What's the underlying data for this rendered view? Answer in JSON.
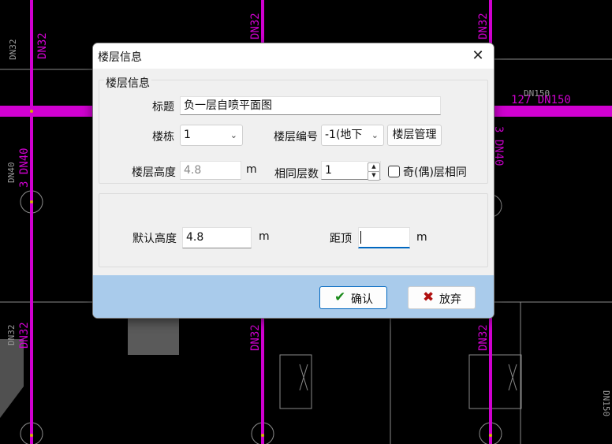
{
  "dialog": {
    "title": "楼层信息",
    "close_glyph": "✕",
    "group1_title": "楼层信息",
    "biaoti_label": "标题",
    "biaoti_value": "负一层自喷平面图",
    "loudong_label": "楼栋",
    "loudong_value": "1",
    "louceng_bianhao_label": "楼层编号",
    "louceng_bianhao_value": "-1(地下",
    "louceng_manage_button": "楼层管理",
    "louceng_gaodu_label": "楼层高度",
    "louceng_gaodu_value": "4.8",
    "unit_m": "m",
    "xiangtong_cengshu_label": "相同层数",
    "xiangtong_cengshu_value": "1",
    "jiou_label": "奇(偶)层相同",
    "moren_gaodu_label": "默认高度",
    "moren_gaodu_value": "4.8",
    "juding_label": "距顶",
    "juding_value": "",
    "ok_label": "确认",
    "cancel_label": "放弃"
  },
  "cad": {
    "labels": [
      "DN32",
      "DN32",
      "DN32",
      "DN32",
      "DN40",
      "DN40",
      "3 DN40",
      "3 DN40",
      "DN150",
      "127 DN150",
      "DN32",
      "DN32",
      "DN32",
      "DN32",
      "DN150"
    ]
  },
  "colors": {
    "pipe": "#d000d0",
    "footer": "#a9cbeb",
    "ok_check": "#1a8a1a",
    "cancel_x": "#b01010"
  }
}
